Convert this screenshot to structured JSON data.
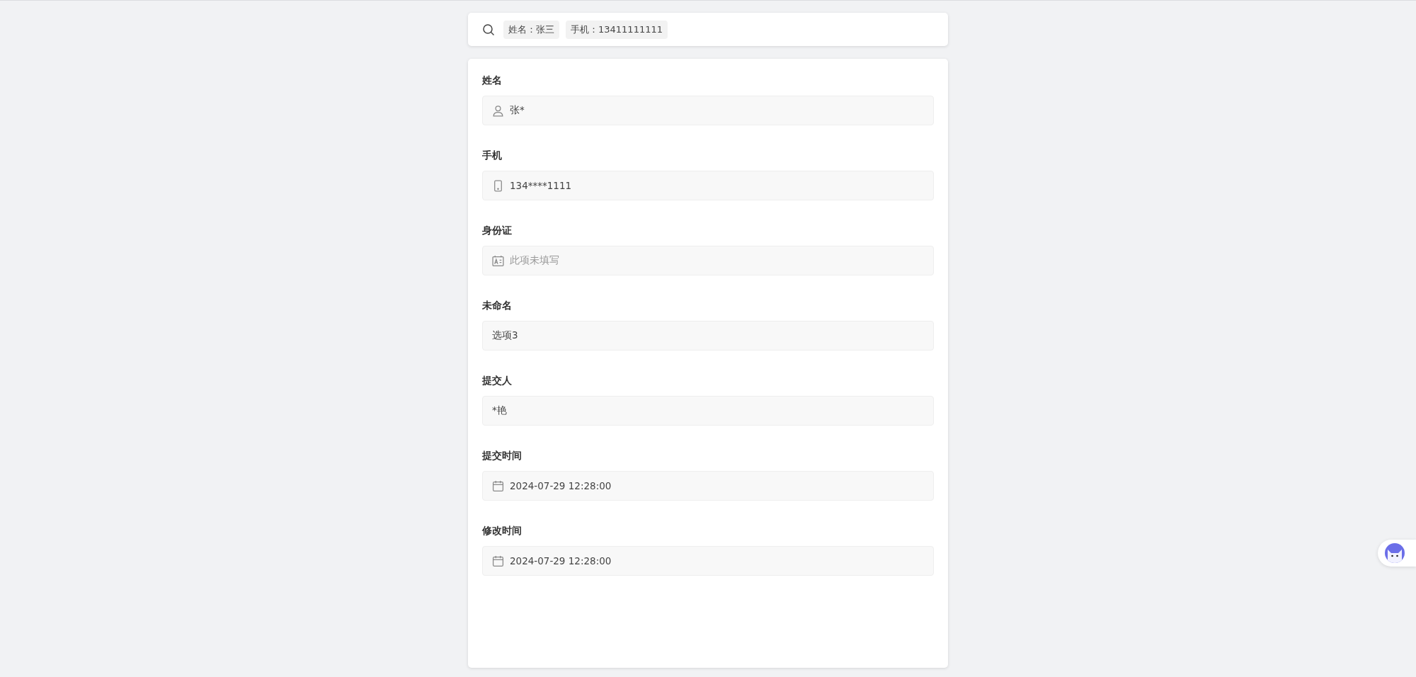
{
  "search": {
    "tags": [
      "姓名：张三",
      "手机：13411111111"
    ]
  },
  "fields": [
    {
      "label": "姓名",
      "kind": "name",
      "value": "张*"
    },
    {
      "label": "手机",
      "kind": "phone",
      "value": "134****1111"
    },
    {
      "label": "身份证",
      "kind": "id_card",
      "placeholder": "此项未填写"
    },
    {
      "label": "未命名",
      "kind": "option",
      "value": "选项3"
    },
    {
      "label": "提交人",
      "kind": "submitter",
      "value": "*艳"
    },
    {
      "label": "提交时间",
      "kind": "datetime",
      "value": "2024-07-29 12:28:00"
    },
    {
      "label": "修改时间",
      "kind": "datetime",
      "value": "2024-07-29 12:28:00"
    }
  ]
}
